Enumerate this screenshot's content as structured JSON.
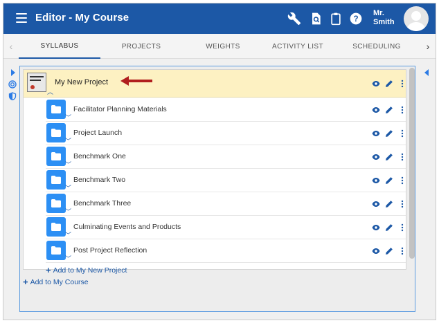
{
  "header": {
    "title": "Editor - My Course",
    "user_line1": "Mr.",
    "user_line2": "Smith",
    "icons": [
      "menu-icon",
      "wrench-icon",
      "document-search-icon",
      "clipboard-icon",
      "help-icon"
    ],
    "background": "#1c58a6"
  },
  "tabs": [
    {
      "label": "SYLLABUS",
      "active": true
    },
    {
      "label": "PROJECTS",
      "active": false
    },
    {
      "label": "WEIGHTS",
      "active": false
    },
    {
      "label": "ACTIVITY LIST",
      "active": false
    },
    {
      "label": "SCHEDULING",
      "active": false
    }
  ],
  "tab_scroll": {
    "left": "‹",
    "right": "›"
  },
  "side_icons": [
    "play-icon",
    "target-icon",
    "shield-icon"
  ],
  "project": {
    "title": "My New Project",
    "thumb_text": "PROJECT TEMPLATE",
    "highlight": "#fdf1c2",
    "annotation": "red-arrow"
  },
  "items": [
    {
      "label": "Facilitator Planning Materials"
    },
    {
      "label": "Project Launch"
    },
    {
      "label": "Benchmark One"
    },
    {
      "label": "Benchmark Two"
    },
    {
      "label": "Benchmark Three"
    },
    {
      "label": "Culminating Events and Products"
    },
    {
      "label": "Post Project Reflection"
    }
  ],
  "add_to_project": "Add to My New Project",
  "add_to_course": "Add to My Course",
  "colors": {
    "accent": "#1c58a6",
    "folder": "#2c8ff4",
    "arrow": "#b01e1e"
  }
}
